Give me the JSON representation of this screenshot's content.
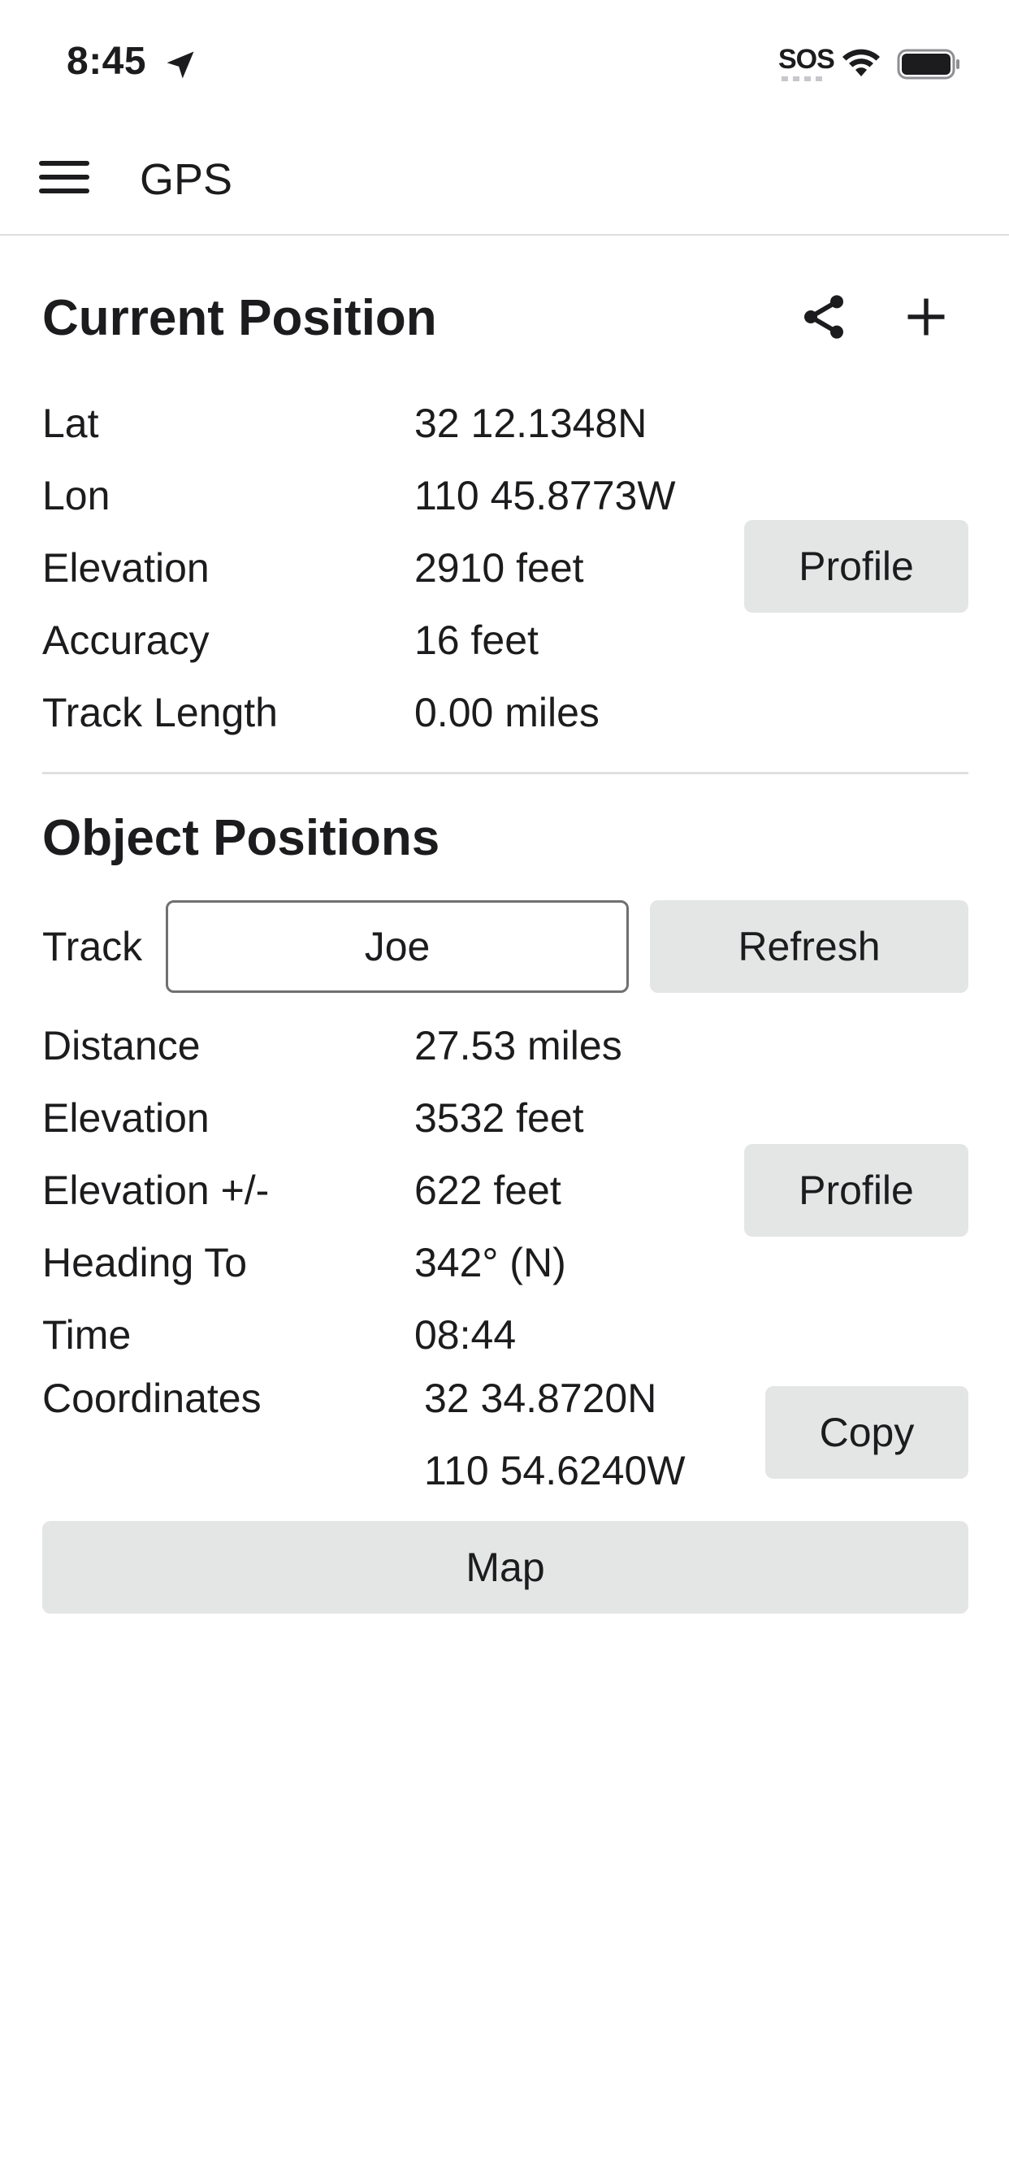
{
  "status_bar": {
    "time": "8:45",
    "sos": "SOS"
  },
  "app_bar": {
    "title": "GPS"
  },
  "current_position": {
    "title": "Current Position",
    "rows": [
      {
        "label": "Lat",
        "value": "32 12.1348N"
      },
      {
        "label": "Lon",
        "value": "110 45.8773W"
      },
      {
        "label": "Elevation",
        "value": "2910 feet"
      },
      {
        "label": "Accuracy",
        "value": "16 feet"
      },
      {
        "label": "Track Length",
        "value": "0.00 miles"
      }
    ],
    "profile_label": "Profile"
  },
  "object_positions": {
    "title": "Object Positions",
    "track_label": "Track",
    "track_value": "Joe",
    "refresh_label": "Refresh",
    "rows": [
      {
        "label": "Distance",
        "value": "27.53 miles"
      },
      {
        "label": "Elevation",
        "value": "3532 feet"
      },
      {
        "label": "Elevation +/-",
        "value": "622 feet"
      },
      {
        "label": "Heading To",
        "value": "342° (N)"
      },
      {
        "label": "Time",
        "value": "08:44"
      }
    ],
    "profile_label": "Profile",
    "coordinates_label": "Coordinates",
    "coordinates_lat": "32 34.8720N",
    "coordinates_lon": "110 54.6240W",
    "copy_label": "Copy",
    "map_label": "Map"
  }
}
